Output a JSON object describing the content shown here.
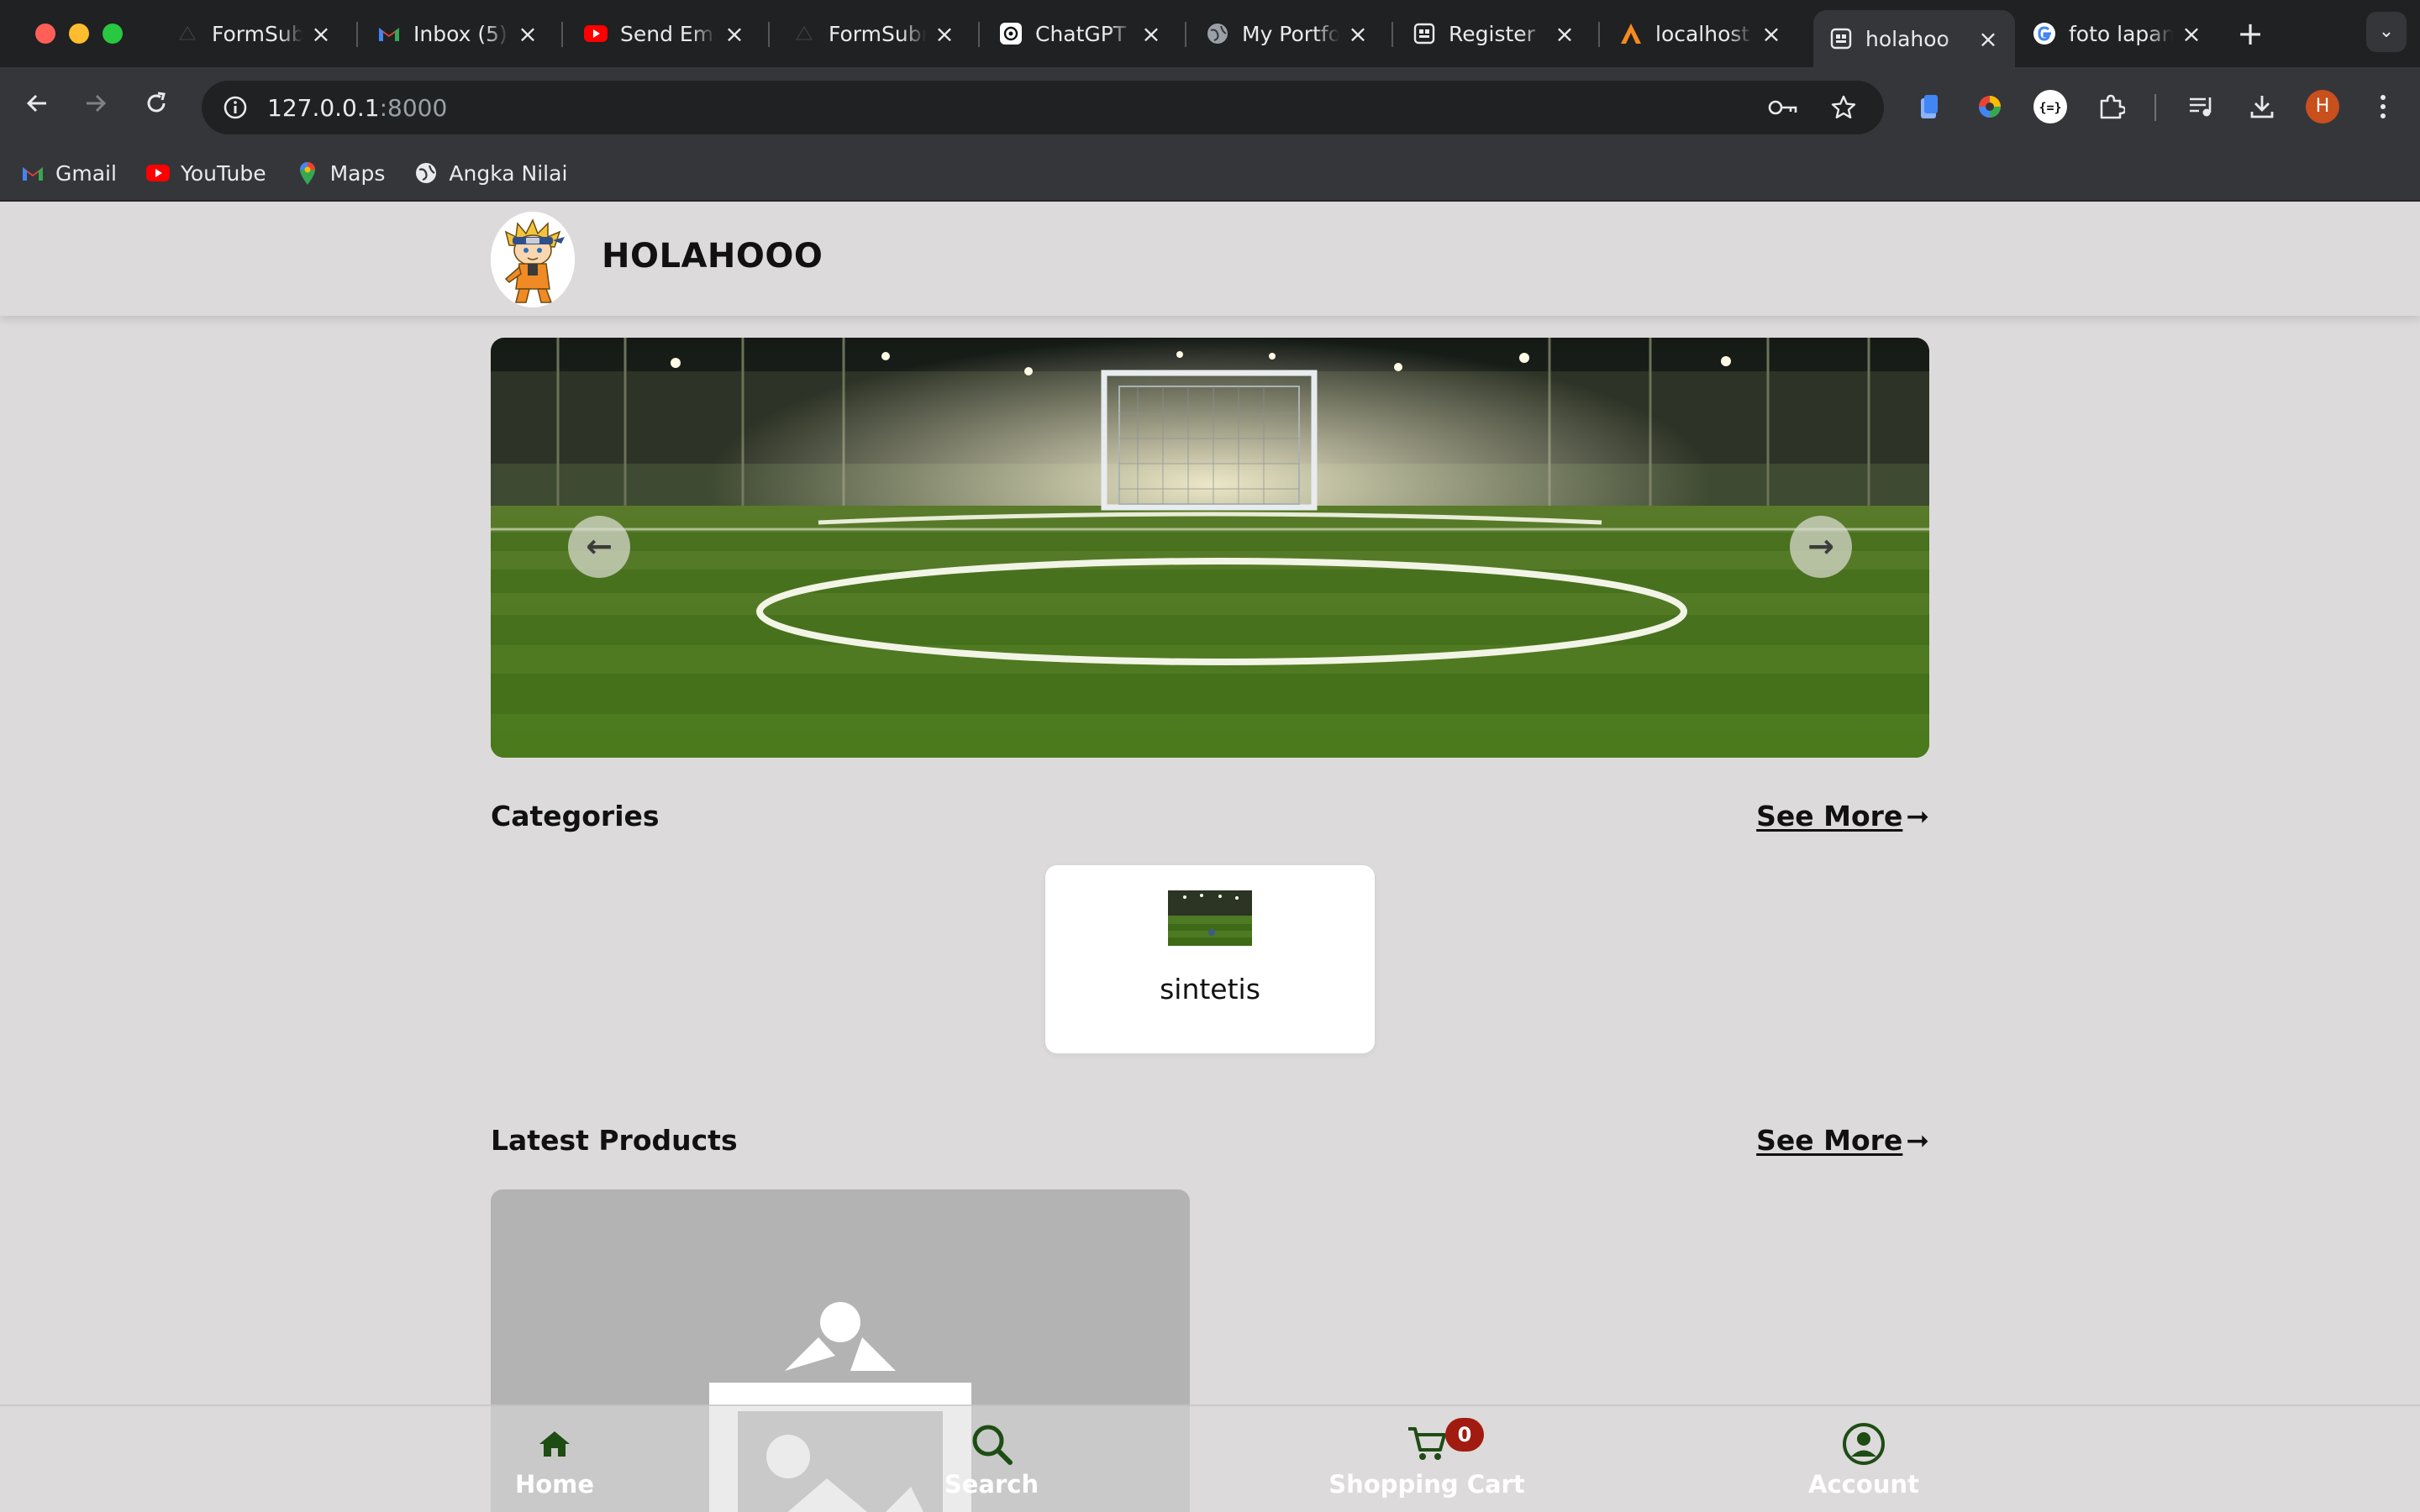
{
  "browser": {
    "tabs": [
      {
        "title": "FormSubmit",
        "icon": "formsubmit-icon"
      },
      {
        "title": "Inbox (5)",
        "icon": "gmail-icon"
      },
      {
        "title": "Send Email",
        "icon": "youtube-icon"
      },
      {
        "title": "FormSubmit",
        "icon": "formsubmit-icon"
      },
      {
        "title": "ChatGPT",
        "icon": "chatgpt-icon"
      },
      {
        "title": "My Portfolio",
        "icon": "globe-icon"
      },
      {
        "title": "Register",
        "icon": "page-icon"
      },
      {
        "title": "localhost",
        "icon": "xampp-icon"
      },
      {
        "title": "holahoo",
        "icon": "page-icon"
      },
      {
        "title": "foto lapangan",
        "icon": "google-icon"
      }
    ],
    "active_tab": 8,
    "url_host": "127.0.0.1",
    "url_port": ":8000",
    "bookmarks": [
      {
        "label": "Gmail",
        "icon": "gmail-icon"
      },
      {
        "label": "YouTube",
        "icon": "youtube-icon"
      },
      {
        "label": "Maps",
        "icon": "maps-icon"
      },
      {
        "label": "Angka Nilai",
        "icon": "globe-icon"
      }
    ],
    "profile_initial": "H"
  },
  "header": {
    "brand": "HOLAHOOO"
  },
  "carousel": {
    "prev_label": "←",
    "next_label": "→"
  },
  "categories": {
    "title": "Categories",
    "see_more": "See More",
    "see_more_arrow": "➞",
    "items": [
      {
        "name": "sintetis"
      }
    ]
  },
  "latest_products": {
    "title": "Latest Products",
    "see_more": "See More",
    "see_more_arrow": "➞"
  },
  "bottom_nav": {
    "home": "Home",
    "search": "Search",
    "cart": "Shopping Cart",
    "cart_count": "0",
    "account": "Account"
  },
  "colors": {
    "page_bg": "#dcdadb",
    "nav_icon": "#1e4d14",
    "cart_badge": "#a11b10"
  }
}
